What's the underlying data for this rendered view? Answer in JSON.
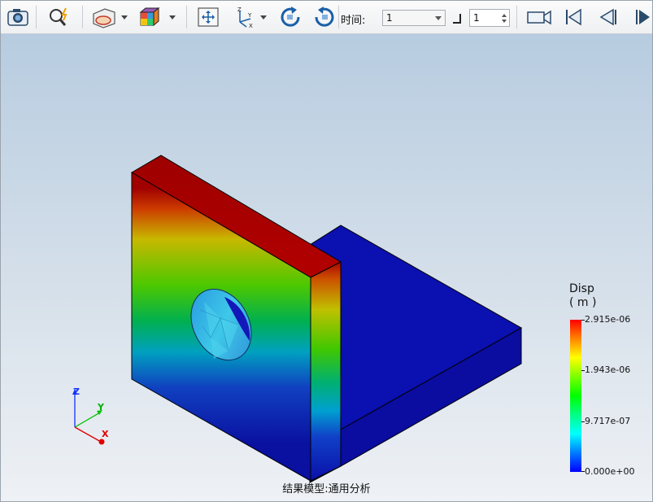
{
  "toolbar": {
    "buttons": [
      {
        "name": "camera-icon"
      },
      {
        "name": "probe-icon"
      },
      {
        "name": "section-view-icon"
      },
      {
        "name": "display-mode-icon"
      },
      {
        "name": "pan-icon"
      },
      {
        "name": "axis-view-icon"
      },
      {
        "name": "rotate-cw-icon"
      },
      {
        "name": "rotate-ccw-icon"
      },
      {
        "name": "record-video-icon"
      },
      {
        "name": "first-frame-icon"
      },
      {
        "name": "prev-frame-icon"
      },
      {
        "name": "next-frame-icon"
      }
    ],
    "time_label": "时间:",
    "time_value": "1",
    "step_value": "1"
  },
  "viewport": {
    "legend": {
      "title": "Disp",
      "unit": "( m )",
      "values": [
        "2.915e-06",
        "1.943e-06",
        "9.717e-07",
        "0.000e+00"
      ]
    },
    "triad": {
      "z_label": "Z",
      "y_label": "Y",
      "x_label": "X"
    },
    "footer": "结果模型:通用分析"
  },
  "colors": {
    "max": "#aa0000",
    "mid": "#00c000",
    "min": "#0000b0",
    "hole": "#33c6e6",
    "background_top": "#b7cce0"
  }
}
